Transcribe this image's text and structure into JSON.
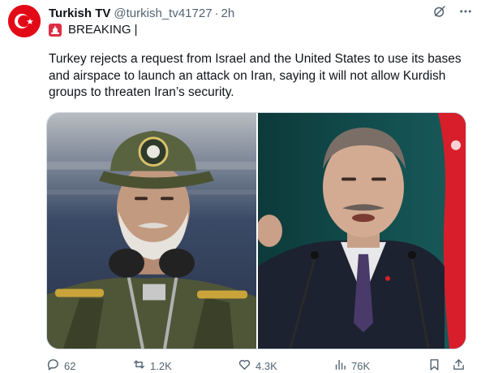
{
  "tweet": {
    "author": {
      "display_name": "Turkish TV",
      "handle": "@turkish_tv41727",
      "separator": "·",
      "time": "2h",
      "avatar_icon": "turkish-flag-avatar"
    },
    "breaking_label": "BREAKING |",
    "breaking_icon": "siren-icon",
    "text": "Turkey rejects a request from Israel and the United States to use its bases and airspace to launch an attack on Iran, saying it will not allow Kurdish groups to threaten Iran’s security.",
    "header_icons": [
      "grok-icon",
      "more-icon"
    ],
    "actions": {
      "replies": "62",
      "reposts": "1.2K",
      "likes": "4.3K",
      "views": "76K"
    },
    "colors": {
      "text": "#0f1419",
      "secondary": "#536471",
      "brand_red": "#e30a17",
      "siren": "#dd2e44"
    }
  }
}
